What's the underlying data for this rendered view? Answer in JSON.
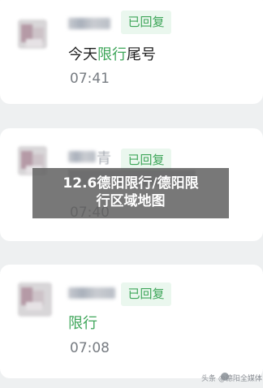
{
  "messages": [
    {
      "reply_badge": "已回复",
      "text_before": "今天",
      "text_highlight": "限行",
      "text_after": "尾号",
      "time": "07:41"
    },
    {
      "name_partial": "青",
      "reply_badge": "已回复",
      "time": "07:40"
    },
    {
      "reply_badge": "已回复",
      "text_highlight": "限行",
      "time": "07:08"
    }
  ],
  "banner": {
    "line1": "12.6德阳限行/德阳限",
    "line2": "行区域地图"
  },
  "watermark": "头条 @德阳全媒体",
  "colors": {
    "accent_green": "#3fa65a",
    "badge_bg": "#eaf7ee",
    "page_bg": "#eef0f1",
    "card_bg": "#ffffff",
    "banner_bg": "#606060"
  }
}
